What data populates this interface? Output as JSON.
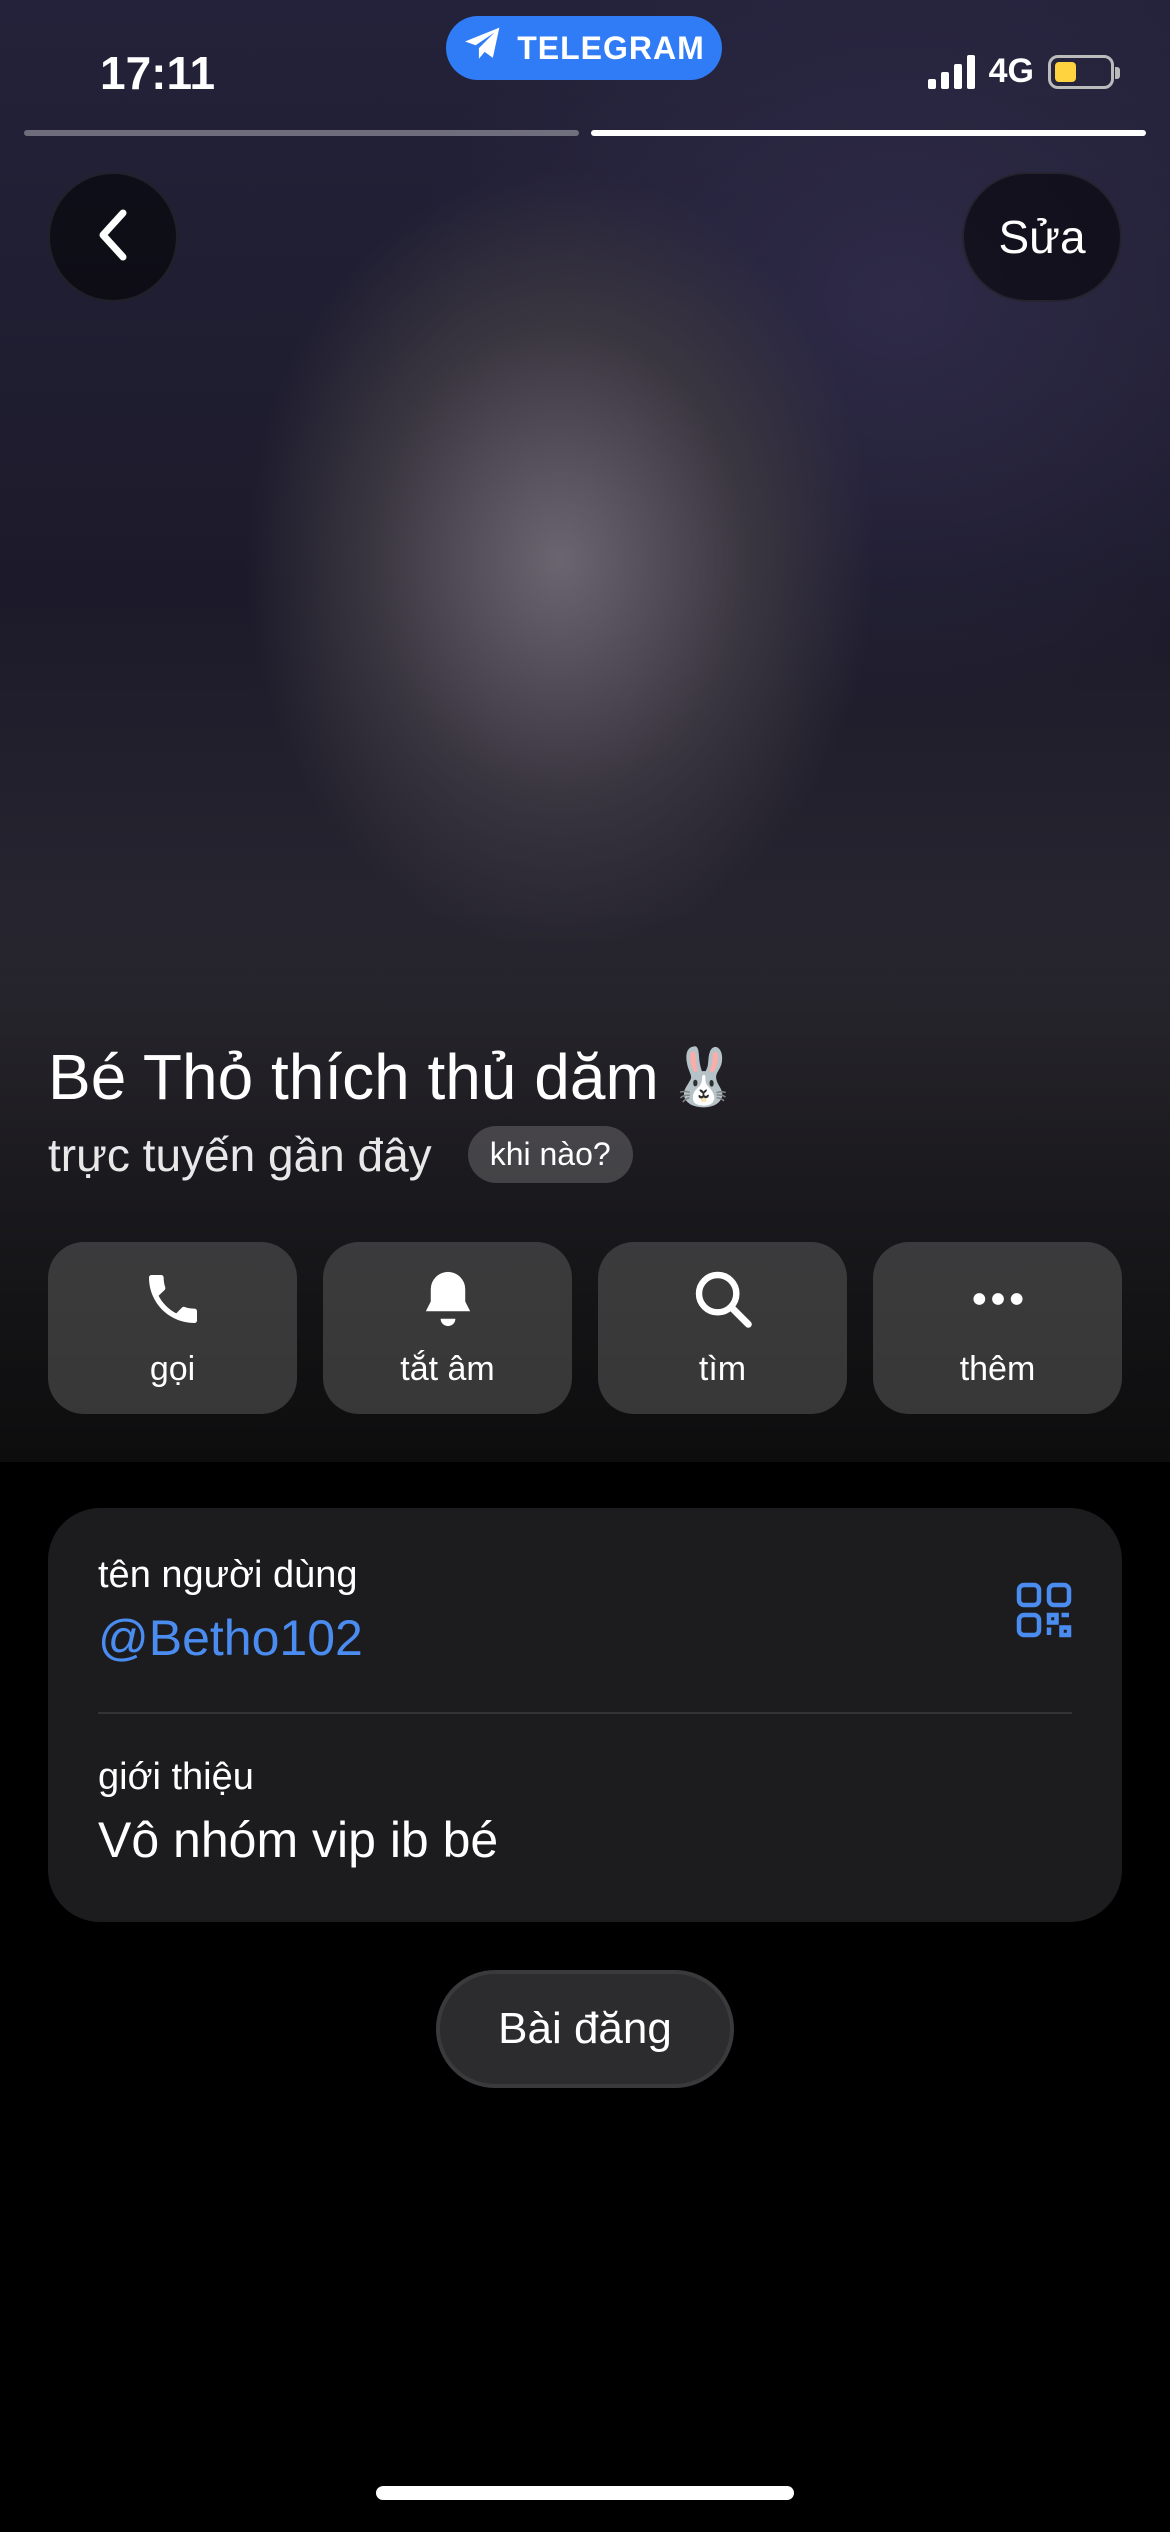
{
  "status_bar": {
    "time": "17:11",
    "network": "4G",
    "battery_level": 0.4
  },
  "app_pill": {
    "label": "TELEGRAM"
  },
  "story_progress": {
    "segments": 2,
    "active_index": 1
  },
  "header": {
    "edit_label": "Sửa"
  },
  "profile": {
    "name": "Bé Thỏ thích thủ dăm",
    "name_emoji": "🐰",
    "last_seen": "trực tuyến gần đây",
    "when_chip": "khi nào?"
  },
  "actions": [
    {
      "label": "gọi",
      "icon": "phone-icon"
    },
    {
      "label": "tắt âm",
      "icon": "bell-icon"
    },
    {
      "label": "tìm",
      "icon": "search-icon"
    },
    {
      "label": "thêm",
      "icon": "more-icon"
    }
  ],
  "info": {
    "username_label": "tên người dùng",
    "username": "@Betho102",
    "bio_label": "giới thiệu",
    "bio": "Vô nhóm vip ib bé"
  },
  "posts_button": {
    "label": "Bài đăng"
  },
  "colors": {
    "accent": "#2f7cf6",
    "link": "#4a8cf0",
    "card": "#1c1c1e"
  }
}
